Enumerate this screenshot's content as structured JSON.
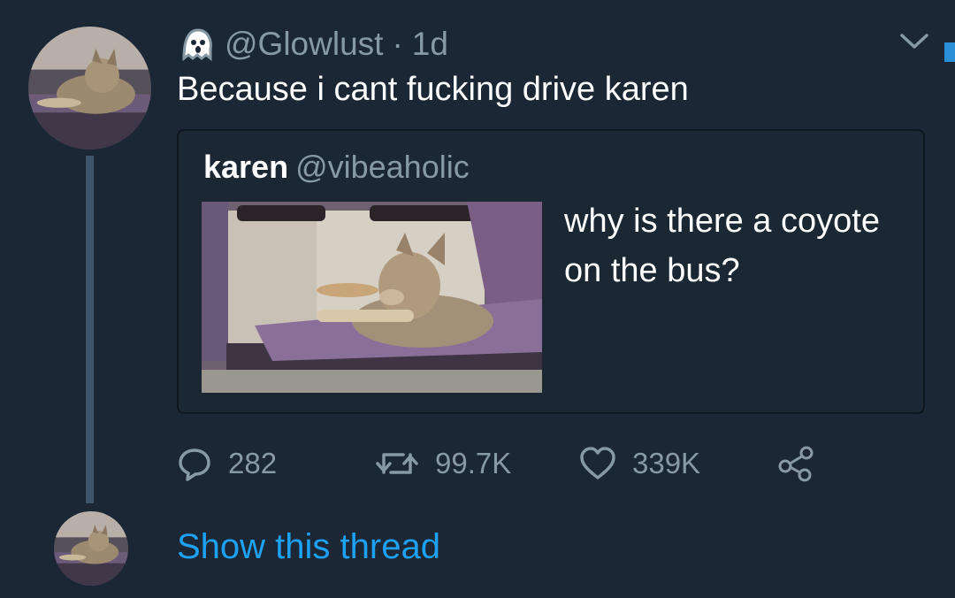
{
  "tweet": {
    "handle": "@Glowlust",
    "separator": "·",
    "time": "1d",
    "text": "Because i cant fucking drive karen",
    "avatar_icon": "coyote-avatar"
  },
  "quote": {
    "name": "karen",
    "handle": "@vibeaholic",
    "text": "why is there a coyote on the bus?",
    "image_icon": "coyote-on-bus-photo"
  },
  "actions": {
    "replies": "282",
    "retweets": "99.7K",
    "likes": "339K"
  },
  "show_thread": "Show this thread",
  "colors": {
    "background": "#1b2735",
    "muted": "#8899a6",
    "link": "#1da1f2",
    "thread_line": "#3f5569"
  }
}
